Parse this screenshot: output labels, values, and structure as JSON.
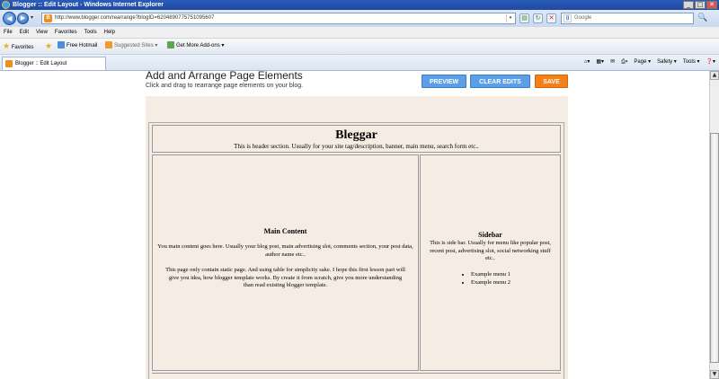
{
  "window": {
    "title": "Blogger :: Edit Layout - Windows Internet Explorer",
    "minimize": "_",
    "maximize": "□",
    "close": "✕"
  },
  "addressbar": {
    "back": "◀",
    "forward": "▶",
    "dropdown": "▾",
    "favicon_letter": "B",
    "url": "http://www.blogger.com/rearrange?blogID=6204890775751095607",
    "url_dropdown": "▾",
    "refresh": "↻",
    "stop": "✕",
    "search_placeholder": "Google",
    "search_engine_letter": "g",
    "search_go": "🔍"
  },
  "menu": [
    "File",
    "Edit",
    "View",
    "Favorites",
    "Tools",
    "Help"
  ],
  "favorites_bar": {
    "favorites_label": "Favorites",
    "hotmail": "Free Hotmail",
    "suggested": "Suggested Sites ▾",
    "addons": "Get More Add-ons ▾"
  },
  "tab": {
    "label": "Blogger :: Edit Layout"
  },
  "command_bar": {
    "page": "Page ▾",
    "safety": "Safety ▾",
    "tools": "Tools ▾",
    "help": "❓▾",
    "home": "⌂▾",
    "feeds": "▦▾",
    "mail": "✉",
    "print": "⎙▾"
  },
  "page": {
    "title": "Add and Arrange Page Elements",
    "subtitle": "Click and drag to rearrange page elements on your blog.",
    "buttons": {
      "preview": "PREVIEW",
      "clear": "CLEAR EDITS",
      "save": "SAVE"
    }
  },
  "layout": {
    "header": {
      "title": "Bleggar",
      "description": "This is header section. Usually for your site tag/description, banner, main menu, search form etc.."
    },
    "main": {
      "title": "Main Content",
      "p1": "You main content goes here. Usually your blog post, main advertising slot, comments section, your post data, author name etc..",
      "p2": "This page only contain static page. And using table for simplicity sake. I hope this first lesson part will give you idea, how blogger template works. By create it from scratch, give you more understanding than read existing blogger template."
    },
    "sidebar": {
      "title": "Sidebar",
      "text": "This is side bar. Usually for menu like popular post, recent post, advertising slot, social networking stuff etc..",
      "items": [
        "Example menu 1",
        "Example menu 2"
      ]
    }
  },
  "scrollbar": {
    "up": "▲",
    "down": "▼"
  },
  "colors": {
    "title_bar": "#1e49a3",
    "blue_button": "#5a9fe8",
    "save_button": "#f57f17",
    "layout_bg": "#f5ede4"
  }
}
